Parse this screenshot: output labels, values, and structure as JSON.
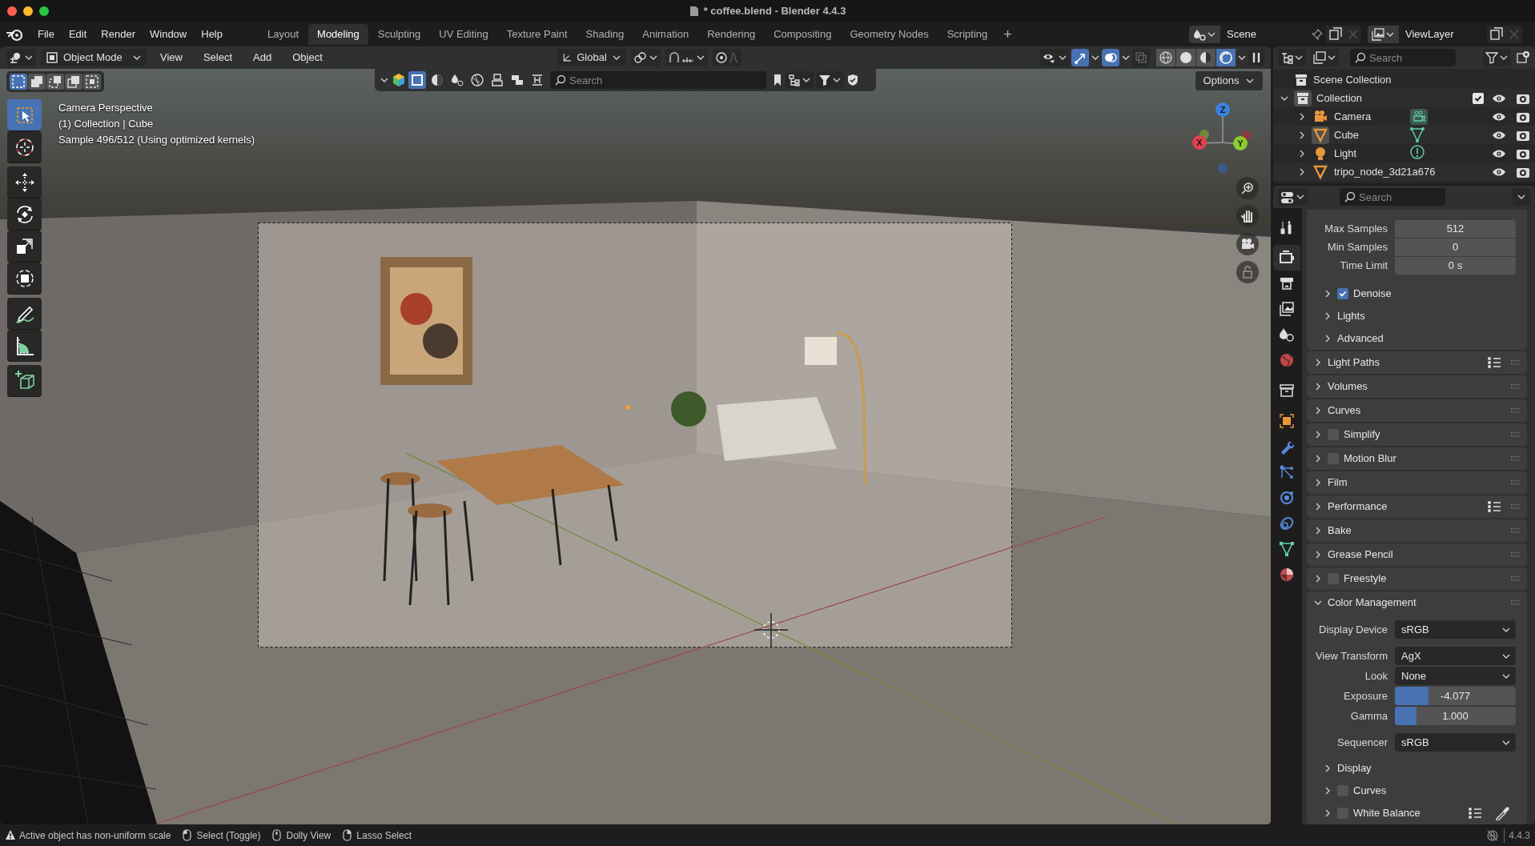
{
  "window": {
    "title": "* coffee.blend - Blender 4.4.3"
  },
  "menu": [
    "File",
    "Edit",
    "Render",
    "Window",
    "Help"
  ],
  "workspaces": [
    {
      "label": "Layout",
      "selected": false
    },
    {
      "label": "Modeling",
      "selected": true
    },
    {
      "label": "Sculpting",
      "selected": false
    },
    {
      "label": "UV Editing",
      "selected": false
    },
    {
      "label": "Texture Paint",
      "selected": false
    },
    {
      "label": "Shading",
      "selected": false
    },
    {
      "label": "Animation",
      "selected": false
    },
    {
      "label": "Rendering",
      "selected": false
    },
    {
      "label": "Compositing",
      "selected": false
    },
    {
      "label": "Geometry Nodes",
      "selected": false
    },
    {
      "label": "Scripting",
      "selected": false
    }
  ],
  "add_workspace": "+",
  "scene": "Scene",
  "view_layer": "ViewLayer",
  "viewport": {
    "mode": "Object Mode",
    "menus": [
      "View",
      "Select",
      "Add",
      "Object"
    ],
    "orientation": "Global",
    "show_gizmos": true,
    "show_overlays": true,
    "shading_modes": [
      {
        "kind": "wireframe",
        "selected": false
      },
      {
        "kind": "solid",
        "selected": false
      },
      {
        "kind": "material",
        "selected": false
      },
      {
        "kind": "rendered",
        "selected": true
      }
    ],
    "select_modes": [
      {
        "selected": true
      },
      {
        "selected": false
      },
      {
        "selected": false
      },
      {
        "selected": false
      },
      {
        "selected": false
      }
    ],
    "shelf_filters": [
      {
        "selected": true
      },
      {
        "selected": false
      },
      {
        "selected": false
      },
      {
        "selected": false
      },
      {
        "selected": false
      },
      {
        "selected": false
      },
      {
        "selected": false
      }
    ],
    "search_placeholder": "Search",
    "options": "Options",
    "info": [
      "Camera Perspective",
      "(1) Collection | Cube",
      "Sample 496/512 (Using optimized kernels)"
    ],
    "gizmo": {
      "x": "X",
      "y": "Y",
      "z": "Z"
    },
    "tools": [
      {
        "kind": "select",
        "selected": true
      },
      {
        "kind": "cursor",
        "selected": false
      },
      {
        "kind": "move",
        "selected": false
      },
      {
        "kind": "rotate",
        "selected": false
      },
      {
        "kind": "scale",
        "selected": false
      },
      {
        "kind": "transform",
        "selected": false
      },
      {
        "kind": "annotate",
        "selected": false
      },
      {
        "kind": "measure",
        "selected": false
      },
      {
        "kind": "add_cube",
        "selected": false
      }
    ]
  },
  "outliner": {
    "search_placeholder": "Search",
    "root": "Scene Collection",
    "collection": {
      "label": "Collection",
      "expanded": true,
      "checked": true,
      "children": [
        {
          "label": "Camera",
          "kind": "camera",
          "expanded": false,
          "active": false
        },
        {
          "label": "Cube",
          "kind": "mesh",
          "expanded": false,
          "active": true
        },
        {
          "label": "Light",
          "kind": "light",
          "expanded": false,
          "active": false
        },
        {
          "label": "tripo_node_3d21a676",
          "kind": "mesh_plain",
          "expanded": false,
          "active": false
        }
      ]
    }
  },
  "properties": {
    "search_placeholder": "Search",
    "tabs": [
      {
        "kind": "tool",
        "selected": false
      },
      {
        "kind": "render",
        "selected": true
      },
      {
        "kind": "output",
        "selected": false
      },
      {
        "kind": "view_layer",
        "selected": false
      },
      {
        "kind": "scene",
        "selected": false
      },
      {
        "kind": "world",
        "selected": false
      },
      {
        "kind": "collection",
        "selected": false
      },
      {
        "kind": "object",
        "selected": false
      },
      {
        "kind": "modifiers",
        "selected": false
      },
      {
        "kind": "particles",
        "selected": false
      },
      {
        "kind": "physics",
        "selected": false
      },
      {
        "kind": "constraints",
        "selected": false
      },
      {
        "kind": "data",
        "selected": false
      },
      {
        "kind": "material",
        "selected": false
      }
    ],
    "sampling_fields": [
      {
        "label": "Max Samples",
        "value": "512"
      },
      {
        "label": "Min Samples",
        "value": "0"
      },
      {
        "label": "Time Limit",
        "value": "0 s"
      }
    ],
    "sampling_subpanels": [
      {
        "label": "Denoise",
        "expanded": false,
        "checked": true
      },
      {
        "label": "Lights",
        "expanded": false
      },
      {
        "label": "Advanced",
        "expanded": false
      }
    ],
    "panels": [
      {
        "label": "Light Paths",
        "expanded": false,
        "presets": true
      },
      {
        "label": "Volumes",
        "expanded": false
      },
      {
        "label": "Curves",
        "expanded": false
      },
      {
        "label": "Simplify",
        "expanded": false,
        "checked": false
      },
      {
        "label": "Motion Blur",
        "expanded": false,
        "checked": false
      },
      {
        "label": "Film",
        "expanded": false
      },
      {
        "label": "Performance",
        "expanded": false,
        "presets": true
      },
      {
        "label": "Bake",
        "expanded": false
      },
      {
        "label": "Grease Pencil",
        "expanded": false
      },
      {
        "label": "Freestyle",
        "expanded": false,
        "checked": false
      },
      {
        "label": "Color Management",
        "expanded": true,
        "fields": [
          {
            "kind": "dropdown",
            "label": "Display Device",
            "value": "sRGB"
          },
          {
            "kind": "dropdown",
            "label": "View Transform",
            "value": "AgX"
          },
          {
            "kind": "dropdown",
            "label": "Look",
            "value": "None"
          },
          {
            "kind": "slider",
            "label": "Exposure",
            "value": "-4.077",
            "level": 0.28
          },
          {
            "kind": "slider",
            "label": "Gamma",
            "value": "1.000",
            "level": 0.18
          },
          {
            "kind": "dropdown",
            "label": "Sequencer",
            "value": "sRGB"
          }
        ],
        "subpanels": [
          {
            "label": "Display",
            "expanded": false
          },
          {
            "label": "Curves",
            "expanded": false,
            "checked": false
          },
          {
            "label": "White Balance",
            "expanded": false,
            "checked": false,
            "presets": true,
            "eyedropper": true
          }
        ]
      }
    ]
  },
  "status_bar": {
    "hints": [
      {
        "kind": "warning",
        "text": "Active object has non-uniform scale"
      },
      {
        "kind": "mouse_left",
        "text": "Select (Toggle)"
      },
      {
        "kind": "mouse_middle",
        "text": "Dolly View"
      },
      {
        "kind": "mouse_right",
        "text": "Lasso Select"
      }
    ],
    "version": "4.4.3"
  }
}
